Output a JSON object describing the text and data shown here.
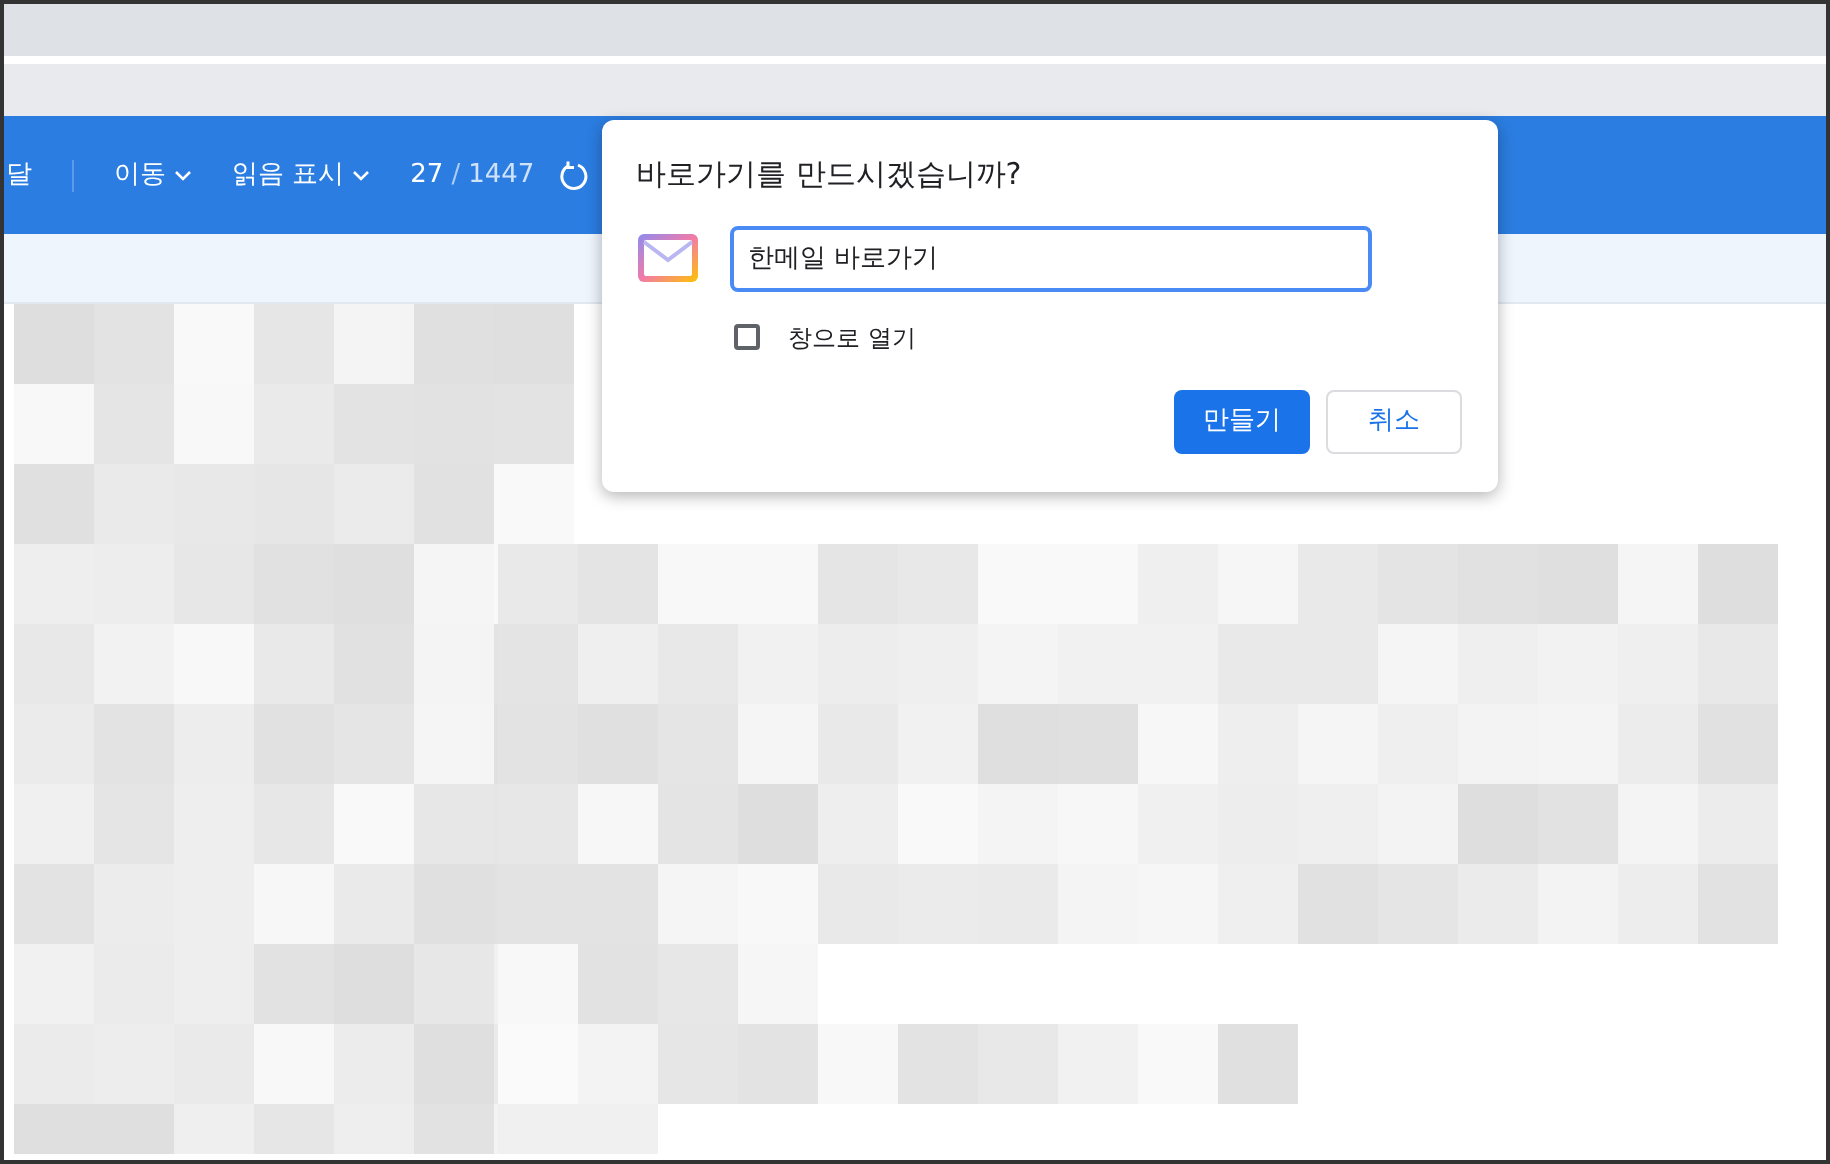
{
  "toolbar": {
    "items": [
      {
        "kind": "text",
        "label": "달"
      },
      {
        "kind": "menu",
        "label": "이동"
      },
      {
        "kind": "menu",
        "label": "읽음 표시"
      }
    ],
    "page_current": "27",
    "page_separator": "/",
    "page_total": "1447"
  },
  "dialog": {
    "title": "바로가기를 만드시겠습니까?",
    "name_field": {
      "value": "한메일 바로가기"
    },
    "open_as_window": {
      "label": "창으로 열기",
      "checked": false
    },
    "buttons": [
      {
        "kind": "primary",
        "label": "만들기"
      },
      {
        "kind": "secondary",
        "label": "취소"
      }
    ]
  }
}
